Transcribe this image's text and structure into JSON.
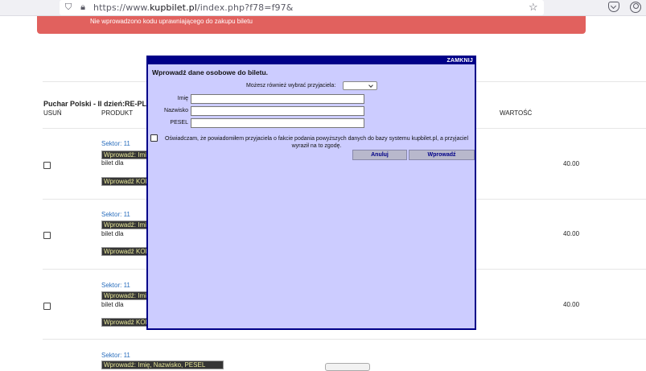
{
  "browser": {
    "url_prefix": "https://www.",
    "url_domain": "kupbilet.pl",
    "url_path": "/index.php?f78=f97&"
  },
  "alert": {
    "message": "Nie wprowadzono kodu uprawniającego do zakupu biletu"
  },
  "cart": {
    "match_title": "Puchar Polski - II dzień:RE-PLAST",
    "headers": {
      "remove": "USUŃ",
      "product": "PRODUKT",
      "value": "WARTOŚĆ"
    },
    "rows": [
      {
        "sector": "Sektor: 11",
        "name_field": "Wprowadź: Imię, Nazwisko, PESEL",
        "bilet_dla": "bilet dla",
        "code_field": "Wprowadź KOD",
        "price": "40.00"
      },
      {
        "sector": "Sektor: 11",
        "name_field": "Wprowadź: Imię, Nazwisko, PESEL",
        "bilet_dla": "bilet dla",
        "code_field": "Wprowadź KOD",
        "price": "40.00"
      },
      {
        "sector": "Sektor: 11",
        "name_field": "Wprowadź: Imię, Nazwisko, PESEL",
        "bilet_dla": "bilet dla",
        "code_field": "Wprowadź KOD",
        "price": "40.00"
      },
      {
        "sector": "Sektor: 11",
        "name_field": "Wprowadź: Imię, Nazwisko, PESEL"
      }
    ]
  },
  "modal": {
    "close_label": "ZAMKNIJ",
    "heading": "Wprowadź dane osobowe do biletu.",
    "friend_label": "Możesz również wybrać przyjaciela:",
    "first_name_label": "Imię",
    "last_name_label": "Nazwisko",
    "pesel_label": "PESEL",
    "first_name_value": "",
    "last_name_value": "",
    "pesel_value": "",
    "consent_text": "Oświadczam, że powiadomiłem przyjaciela o fakcie podania powyższych danych do bazy systemu kupbilet.pl, a przyjaciel wyraził na to zgodę.",
    "cancel_label": "Anuluj",
    "submit_label": "Wprowadź"
  },
  "colors": {
    "alert": "#e1615e",
    "modal_bg": "#ccccff",
    "modal_border": "#000088",
    "link": "#2a6ebd"
  },
  "icons": [
    "shield-icon",
    "lock-icon",
    "star-icon",
    "pocket-icon",
    "account-icon"
  ]
}
